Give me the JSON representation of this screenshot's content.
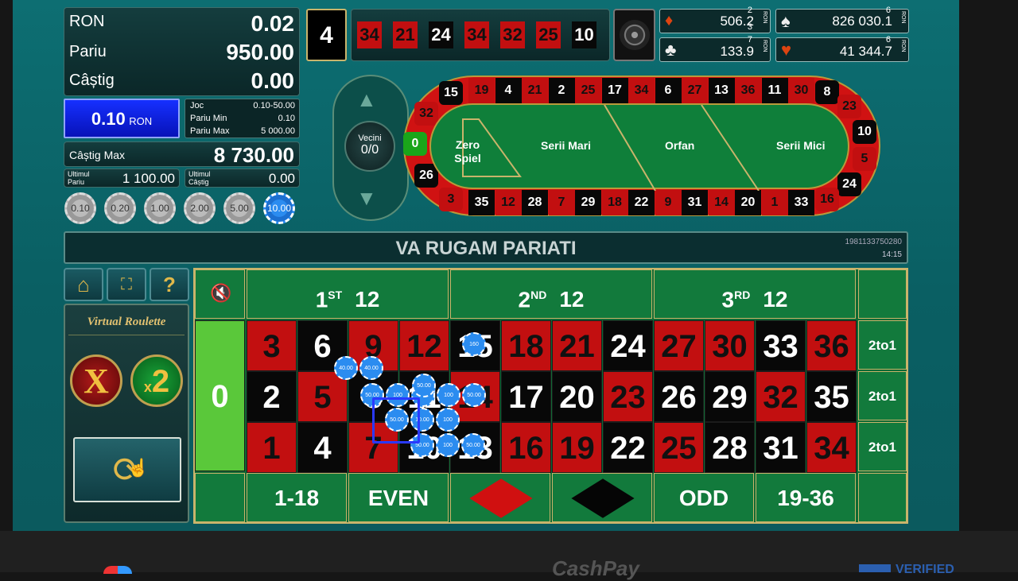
{
  "account": {
    "currency_label": "RON",
    "currency_value": "0.02",
    "bet_label": "Pariu",
    "bet_value": "950.00",
    "win_label": "Câștig",
    "win_value": "0.00"
  },
  "denomination": {
    "value": "0.10",
    "unit": "RON"
  },
  "limits": {
    "game_label": "Joc",
    "game_value": "0.10-50.00",
    "min_label": "Pariu Min",
    "min_value": "0.10",
    "max_label": "Pariu Max",
    "max_value": "5 000.00"
  },
  "max_win": {
    "label": "Câștig Max",
    "value": "8 730.00"
  },
  "last_bet": {
    "label": "Ultimul Pariu",
    "value": "1 100.00"
  },
  "last_win": {
    "label": "Ultimul Câștig",
    "value": "0.00"
  },
  "chips": [
    "0.10",
    "0.20",
    "1.00",
    "2.00",
    "5.00",
    "10.00"
  ],
  "selected_chip_index": 5,
  "last_result": "4",
  "history": [
    {
      "n": "34",
      "c": "red"
    },
    {
      "n": "21",
      "c": "red"
    },
    {
      "n": "24",
      "c": "blk"
    },
    {
      "n": "34",
      "c": "red"
    },
    {
      "n": "32",
      "c": "red"
    },
    {
      "n": "25",
      "c": "red"
    },
    {
      "n": "10",
      "c": "blk"
    }
  ],
  "jackpots": {
    "diamond": {
      "value": "506.2",
      "sup": "2",
      "sub": "3"
    },
    "spade": {
      "value": "826 030.1",
      "sup": "6",
      "sub": "6"
    },
    "club": {
      "value": "133.9",
      "sup": "7",
      "sub": ""
    },
    "heart": {
      "value": "41 344.7",
      "sup": "6",
      "sub": ""
    },
    "unit": "RON"
  },
  "racetrack": {
    "top": [
      {
        "n": "19",
        "c": "red"
      },
      {
        "n": "4",
        "c": "blk"
      },
      {
        "n": "21",
        "c": "red"
      },
      {
        "n": "2",
        "c": "blk"
      },
      {
        "n": "25",
        "c": "red"
      },
      {
        "n": "17",
        "c": "blk"
      },
      {
        "n": "34",
        "c": "red"
      },
      {
        "n": "6",
        "c": "blk"
      },
      {
        "n": "27",
        "c": "red"
      },
      {
        "n": "13",
        "c": "blk"
      },
      {
        "n": "36",
        "c": "red"
      },
      {
        "n": "11",
        "c": "blk"
      },
      {
        "n": "30",
        "c": "red"
      }
    ],
    "bottom": [
      {
        "n": "35",
        "c": "blk"
      },
      {
        "n": "12",
        "c": "red"
      },
      {
        "n": "28",
        "c": "blk"
      },
      {
        "n": "7",
        "c": "red"
      },
      {
        "n": "29",
        "c": "blk"
      },
      {
        "n": "18",
        "c": "red"
      },
      {
        "n": "22",
        "c": "blk"
      },
      {
        "n": "9",
        "c": "red"
      },
      {
        "n": "31",
        "c": "blk"
      },
      {
        "n": "14",
        "c": "red"
      },
      {
        "n": "20",
        "c": "blk"
      },
      {
        "n": "1",
        "c": "red"
      },
      {
        "n": "33",
        "c": "blk"
      }
    ],
    "left": [
      {
        "n": "15",
        "c": "blk"
      },
      {
        "n": "32",
        "c": "red"
      },
      {
        "n": "0",
        "c": "grn"
      },
      {
        "n": "26",
        "c": "blk"
      },
      {
        "n": "3",
        "c": "red"
      }
    ],
    "right": [
      {
        "n": "8",
        "c": "blk"
      },
      {
        "n": "23",
        "c": "red"
      },
      {
        "n": "10",
        "c": "blk"
      },
      {
        "n": "5",
        "c": "red"
      },
      {
        "n": "24",
        "c": "blk"
      },
      {
        "n": "16",
        "c": "red"
      }
    ],
    "sections": [
      "Zero Spiel",
      "Serii Mari",
      "Orfan",
      "Serii Mici"
    ],
    "neighbors_label": "Vecini",
    "neighbors_value": "0/0"
  },
  "banner": {
    "message": "VA RUGAM PARIATI",
    "round_id": "1981133750280",
    "time": "14:15"
  },
  "logo": "Virtual Roulette",
  "table": {
    "dozens": [
      {
        "n": "1",
        "sup": "ST",
        "v": "12"
      },
      {
        "n": "2",
        "sup": "ND",
        "v": "12"
      },
      {
        "n": "3",
        "sup": "RD",
        "v": "12"
      }
    ],
    "zero": "0",
    "rows": [
      [
        {
          "n": "3",
          "c": "red"
        },
        {
          "n": "6",
          "c": "blk"
        },
        {
          "n": "9",
          "c": "red"
        },
        {
          "n": "12",
          "c": "red"
        },
        {
          "n": "15",
          "c": "blk"
        },
        {
          "n": "18",
          "c": "red"
        },
        {
          "n": "21",
          "c": "red"
        },
        {
          "n": "24",
          "c": "blk"
        },
        {
          "n": "27",
          "c": "red"
        },
        {
          "n": "30",
          "c": "red"
        },
        {
          "n": "33",
          "c": "blk"
        },
        {
          "n": "36",
          "c": "red"
        }
      ],
      [
        {
          "n": "2",
          "c": "blk"
        },
        {
          "n": "5",
          "c": "red"
        },
        {
          "n": "8",
          "c": "blk"
        },
        {
          "n": "11",
          "c": "blk"
        },
        {
          "n": "14",
          "c": "red"
        },
        {
          "n": "17",
          "c": "blk"
        },
        {
          "n": "20",
          "c": "blk"
        },
        {
          "n": "23",
          "c": "red"
        },
        {
          "n": "26",
          "c": "blk"
        },
        {
          "n": "29",
          "c": "blk"
        },
        {
          "n": "32",
          "c": "red"
        },
        {
          "n": "35",
          "c": "blk"
        }
      ],
      [
        {
          "n": "1",
          "c": "red"
        },
        {
          "n": "4",
          "c": "blk"
        },
        {
          "n": "7",
          "c": "red"
        },
        {
          "n": "10",
          "c": "blk"
        },
        {
          "n": "13",
          "c": "blk"
        },
        {
          "n": "16",
          "c": "red"
        },
        {
          "n": "19",
          "c": "red"
        },
        {
          "n": "22",
          "c": "blk"
        },
        {
          "n": "25",
          "c": "red"
        },
        {
          "n": "28",
          "c": "blk"
        },
        {
          "n": "31",
          "c": "blk"
        },
        {
          "n": "34",
          "c": "red"
        }
      ]
    ],
    "column_bets": [
      "2to1",
      "2to1",
      "2to1"
    ],
    "outside": [
      "1-18",
      "EVEN",
      "",
      "",
      "ODD",
      "19-36"
    ],
    "bet_chips": [
      "40.00",
      "40.00",
      "50.00",
      "100",
      "100",
      "100",
      "50.00",
      "50.00",
      "10.00",
      "100",
      "160",
      "50.00",
      "100",
      "50.00",
      "50.00"
    ]
  },
  "footer_text": "CashPay",
  "footer_right": "VERIFIED",
  "colors": {
    "red": "#c20f10",
    "black": "#080808",
    "green": "#1aa51a",
    "felt": "#127a3c",
    "chip": "#2b8cf0"
  }
}
